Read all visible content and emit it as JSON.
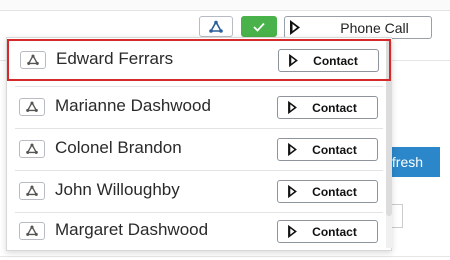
{
  "toolbar": {
    "phone_call_label": "Phone Call",
    "user_icon": "triangle-people-icon",
    "check_icon": "checkmark-icon",
    "call_icon": "dynamics-logo-icon",
    "check_color": "#49b24a"
  },
  "background": {
    "refresh_label": "Refresh",
    "refresh_color": "#2b87c9"
  },
  "dropdown": {
    "highlight_color": "#d42a2a",
    "items": [
      {
        "name": "Edward Ferrars",
        "action": "Contact"
      },
      {
        "name": "Marianne Dashwood",
        "action": "Contact"
      },
      {
        "name": "Colonel Brandon",
        "action": "Contact"
      },
      {
        "name": "John Willoughby",
        "action": "Contact"
      },
      {
        "name": "Margaret Dashwood",
        "action": "Contact"
      }
    ]
  }
}
